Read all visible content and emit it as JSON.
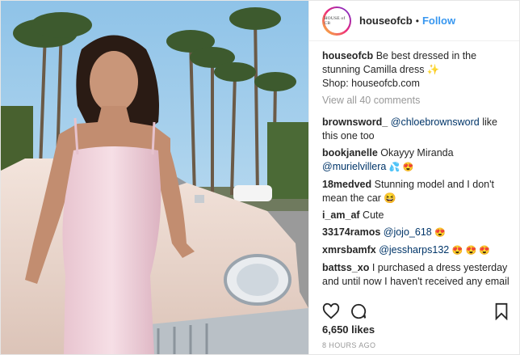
{
  "header": {
    "username": "houseofcb",
    "avatar_text": "HOUSE of CB",
    "separator": "•",
    "follow_label": "Follow"
  },
  "caption": {
    "username": "houseofcb",
    "text": "Be best dressed in the stunning Camilla dress ✨",
    "shop": "Shop: houseofcb.com"
  },
  "view_all": "View all 40 comments",
  "comments": [
    {
      "user": "brownsword_",
      "mention": "@chloebrownsword",
      "text": "like this one too"
    },
    {
      "user": "bookjanelle",
      "text": "Okayyy Miranda",
      "mention": "@murielvillera",
      "emoji": "💦 😍"
    },
    {
      "user": "18medved",
      "text": "Stunning model and I don't mean the car 😆"
    },
    {
      "user": "i_am_af",
      "text": "Cute"
    },
    {
      "user": "33174ramos",
      "mention": "@jojo_618",
      "emoji": "😍"
    },
    {
      "user": "xmrsbamfx",
      "mention": "@jessharps132",
      "emoji": "😍 😍 😍"
    },
    {
      "user": "battss_xo",
      "text": "I purchased a dress yesterday and until now I haven't received any email saying that my purchase have been confirmed or shipped. It's been a day and normally when I shop with other brands"
    }
  ],
  "likes": "6,650 likes",
  "time": "8 HOURS AGO",
  "icons": {
    "like": "heart-icon",
    "comment": "comment-bubble-icon",
    "save": "bookmark-icon"
  },
  "colors": {
    "follow": "#3897f0",
    "mention": "#003569",
    "muted": "#999999"
  }
}
